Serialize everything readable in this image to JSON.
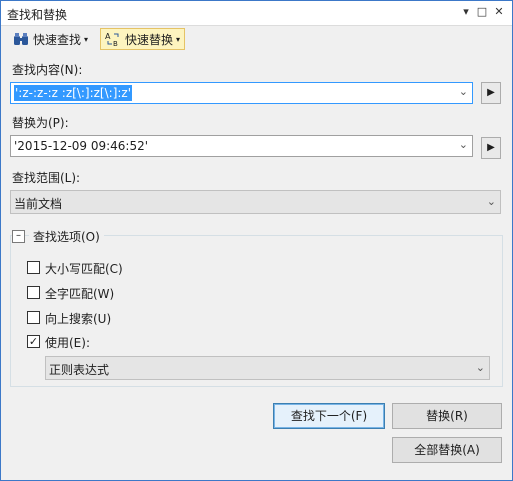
{
  "window": {
    "title": "查找和替换",
    "controls": {
      "dropdown": "▾",
      "maximize": "□",
      "close": "✕"
    }
  },
  "toolbar": {
    "quick_find": "快速查找",
    "quick_replace": "快速替换"
  },
  "find": {
    "label": "查找内容(N):",
    "value": "':z-:z-:z :z[\\:]:z[\\:]:z'"
  },
  "replace": {
    "label": "替换为(P):",
    "value": "'2015-12-09 09:46:52'"
  },
  "scope": {
    "label": "查找范围(L):",
    "selected": "当前文档"
  },
  "options": {
    "title": "查找选项(O)",
    "collapse_glyph": "–",
    "match_case": {
      "label": "大小写匹配(C)",
      "checked": false
    },
    "whole_word": {
      "label": "全字匹配(W)",
      "checked": false
    },
    "search_up": {
      "label": "向上搜索(U)",
      "checked": false
    },
    "use": {
      "label": "使用(E):",
      "checked": true,
      "check_glyph": "✓"
    },
    "use_mode": "正则表达式"
  },
  "buttons": {
    "find_next": "查找下一个(F)",
    "replace": "替换(R)",
    "replace_all": "全部替换(A)"
  },
  "icons": {
    "expand_arrow": "▶",
    "combo_arrow": "⌄",
    "toolbar_arrow": "▾"
  }
}
